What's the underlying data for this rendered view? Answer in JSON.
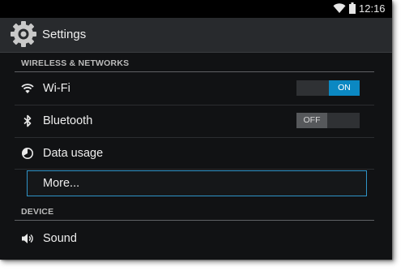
{
  "status_bar": {
    "time": "12:16",
    "icons": [
      "wifi-icon",
      "battery-icon"
    ]
  },
  "action_bar": {
    "title": "Settings",
    "icon": "settings-gear-icon"
  },
  "sections": [
    {
      "header": "WIRELESS & NETWORKS",
      "items": [
        {
          "label": "Wi-Fi",
          "icon": "wifi-icon",
          "toggle": "ON"
        },
        {
          "label": "Bluetooth",
          "icon": "bluetooth-icon",
          "toggle": "OFF"
        },
        {
          "label": "Data usage",
          "icon": "data-usage-icon"
        },
        {
          "label": "More...",
          "focused": true
        }
      ]
    },
    {
      "header": "DEVICE",
      "items": [
        {
          "label": "Sound",
          "icon": "sound-icon"
        }
      ]
    }
  ],
  "colors": {
    "accent": "#0b88c2",
    "focus_border": "#2f94c8",
    "background": "#111214",
    "action_bar": "#282a2d"
  }
}
